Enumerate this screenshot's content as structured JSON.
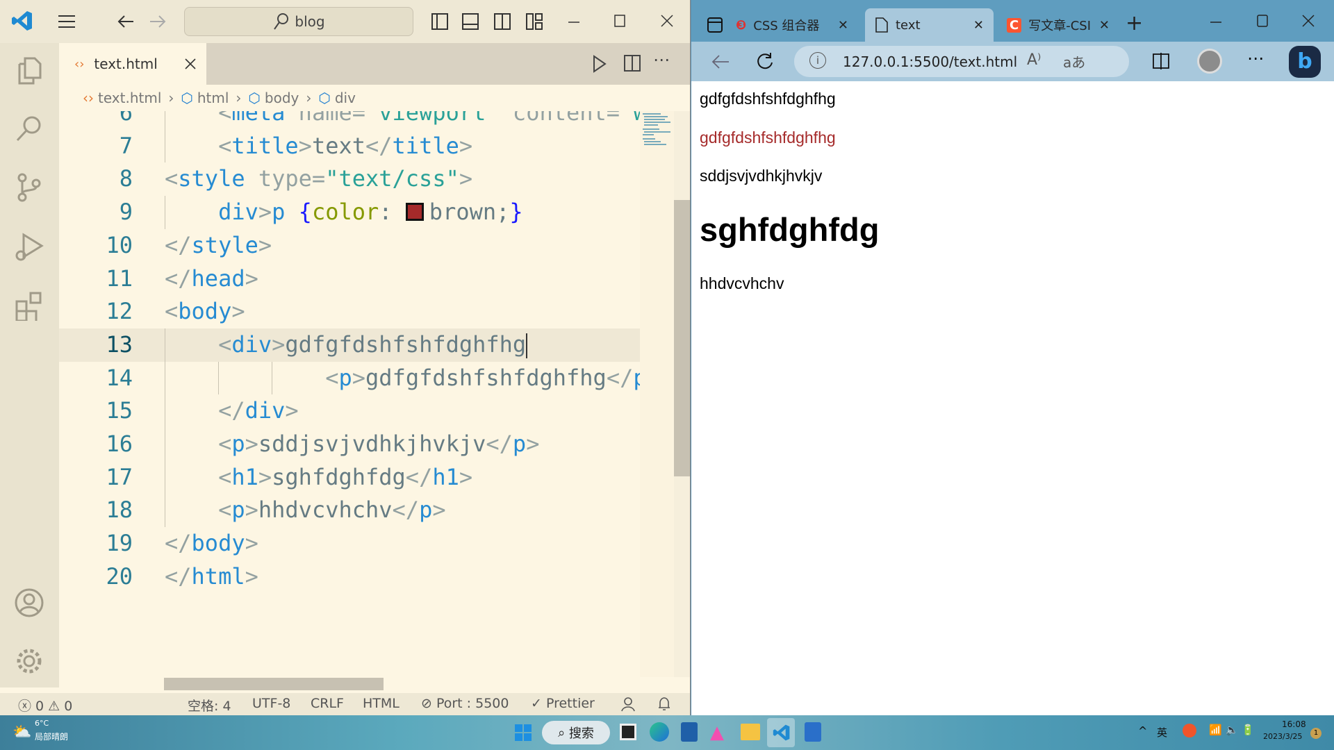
{
  "vscode": {
    "search_text": "blog",
    "tab": {
      "label": "text.html"
    },
    "breadcrumb": [
      "text.html",
      "html",
      "body",
      "div"
    ],
    "code_lines": [
      {
        "n": "6",
        "indent": 4,
        "tokens": [
          [
            "p",
            "<"
          ],
          [
            "t",
            "meta "
          ],
          [
            "a",
            "name="
          ],
          [
            "s",
            "\"viewport\" "
          ],
          [
            "a",
            "content="
          ],
          [
            "s",
            "\"w"
          ]
        ]
      },
      {
        "n": "7",
        "indent": 4,
        "tokens": [
          [
            "p",
            "<"
          ],
          [
            "t",
            "title"
          ],
          [
            "p",
            ">"
          ],
          [
            "x",
            "text"
          ],
          [
            "p",
            "</"
          ],
          [
            "t",
            "title"
          ],
          [
            "p",
            ">"
          ]
        ]
      },
      {
        "n": "8",
        "indent": 0,
        "tokens": [
          [
            "p",
            "<"
          ],
          [
            "t",
            "style "
          ],
          [
            "a",
            "type="
          ],
          [
            "s",
            "\"text/css\""
          ],
          [
            "p",
            ">"
          ]
        ]
      },
      {
        "n": "9",
        "indent": 4,
        "tokens": [
          [
            "t",
            "div"
          ],
          [
            "p",
            ">"
          ],
          [
            "t",
            "p "
          ],
          [
            "b",
            "{"
          ],
          [
            "pr",
            "color"
          ],
          [
            "x",
            ": "
          ],
          [
            "swatch",
            "#a52a2a"
          ],
          [
            "x",
            "brown;"
          ],
          [
            "b",
            "}"
          ]
        ]
      },
      {
        "n": "10",
        "indent": 0,
        "tokens": [
          [
            "p",
            "</"
          ],
          [
            "t",
            "style"
          ],
          [
            "p",
            ">"
          ]
        ]
      },
      {
        "n": "11",
        "indent": 0,
        "tokens": [
          [
            "p",
            "</"
          ],
          [
            "t",
            "head"
          ],
          [
            "p",
            ">"
          ]
        ]
      },
      {
        "n": "12",
        "indent": 0,
        "tokens": [
          [
            "p",
            "<"
          ],
          [
            "t",
            "body"
          ],
          [
            "p",
            ">"
          ]
        ]
      },
      {
        "n": "13",
        "indent": 4,
        "current": true,
        "tokens": [
          [
            "p",
            "<"
          ],
          [
            "t",
            "div"
          ],
          [
            "p",
            ">"
          ],
          [
            "x",
            "gdfgfdshfshfdghfhg"
          ]
        ]
      },
      {
        "n": "14",
        "indent": 12,
        "tokens": [
          [
            "p",
            "<"
          ],
          [
            "t",
            "p"
          ],
          [
            "p",
            ">"
          ],
          [
            "x",
            "gdfgfdshfshfdghfhg"
          ],
          [
            "p",
            "</"
          ],
          [
            "t",
            "p"
          ],
          [
            "p",
            ">"
          ]
        ]
      },
      {
        "n": "15",
        "indent": 4,
        "tokens": [
          [
            "p",
            "</"
          ],
          [
            "t",
            "div"
          ],
          [
            "p",
            ">"
          ]
        ]
      },
      {
        "n": "16",
        "indent": 4,
        "tokens": [
          [
            "p",
            "<"
          ],
          [
            "t",
            "p"
          ],
          [
            "p",
            ">"
          ],
          [
            "x",
            "sddjsvjvdhkjhvkjv"
          ],
          [
            "p",
            "</"
          ],
          [
            "t",
            "p"
          ],
          [
            "p",
            ">"
          ]
        ]
      },
      {
        "n": "17",
        "indent": 4,
        "tokens": [
          [
            "p",
            "<"
          ],
          [
            "t",
            "h1"
          ],
          [
            "p",
            ">"
          ],
          [
            "x",
            "sghfdghfdg"
          ],
          [
            "p",
            "</"
          ],
          [
            "t",
            "h1"
          ],
          [
            "p",
            ">"
          ]
        ]
      },
      {
        "n": "18",
        "indent": 4,
        "tokens": [
          [
            "p",
            "<"
          ],
          [
            "t",
            "p"
          ],
          [
            "p",
            ">"
          ],
          [
            "x",
            "hhdvcvhchv"
          ],
          [
            "p",
            "</"
          ],
          [
            "t",
            "p"
          ],
          [
            "p",
            ">"
          ]
        ]
      },
      {
        "n": "19",
        "indent": 0,
        "tokens": [
          [
            "p",
            "</"
          ],
          [
            "t",
            "body"
          ],
          [
            "p",
            ">"
          ]
        ]
      },
      {
        "n": "20",
        "indent": 0,
        "tokens": [
          [
            "p",
            "</"
          ],
          [
            "t",
            "html"
          ],
          [
            "p",
            ">"
          ]
        ]
      }
    ],
    "status": {
      "errors": "0",
      "warnings": "0",
      "spaces": "空格: 4",
      "encoding": "UTF-8",
      "eol": "CRLF",
      "language": "HTML",
      "port": "Port : 5500",
      "formatter": "Prettier"
    }
  },
  "browser": {
    "tabs": [
      {
        "label": "CSS 组合器",
        "icon": "site-logo-icon"
      },
      {
        "label": "text",
        "icon": "page-icon",
        "active": true
      },
      {
        "label": "写文章-CSI",
        "icon": "csdn-icon"
      }
    ],
    "url": "127.0.0.1:5500/text.html",
    "content": {
      "div_text": "gdfgfdshfshfdghfhg",
      "div_p": "gdfgfdshfshfdghfhg",
      "p1": "sddjsvjvdhkjhvkjv",
      "h1": "sghfdghfdg",
      "p2": "hhdvcvhchv"
    },
    "colors": {
      "div_p": "#a52a2a"
    }
  },
  "taskbar": {
    "weather_temp": "6°C",
    "weather_desc": "局部晴朗",
    "search_label": "搜索",
    "tray_lang": "英",
    "time": "16:08",
    "date": "2023/3/25"
  }
}
